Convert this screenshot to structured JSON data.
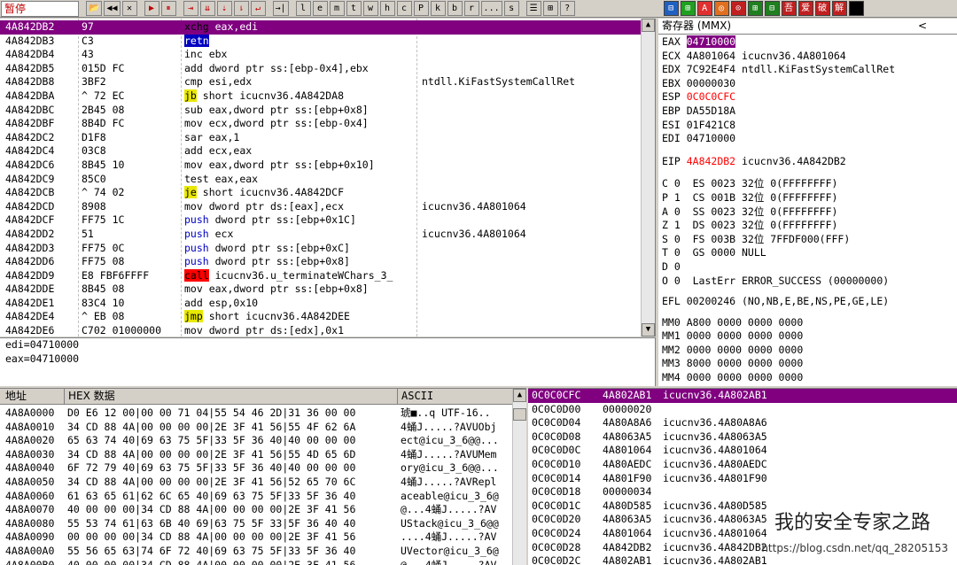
{
  "status": "暂停",
  "toolbar": {
    "buttons": [
      "📂",
      "◀◀",
      "✕",
      "▶",
      "⏸",
      "⇥",
      "⇊",
      "⇣",
      "⇂",
      "↵",
      "→|"
    ],
    "letters": [
      "l",
      "e",
      "m",
      "t",
      "w",
      "h",
      "c",
      "P",
      "k",
      "b",
      "r",
      "...",
      "s"
    ],
    "tools": [
      "☰",
      "⊞",
      "?"
    ],
    "plugins": [
      "⊟",
      "⊞",
      "A",
      "◎",
      "⊙",
      "⊞",
      "⊟",
      "吾",
      "爱",
      "破",
      "解",
      ""
    ]
  },
  "disasm": {
    "rows": [
      {
        "addr": "4A842DB2",
        "hex": "97",
        "mnem": "xchg",
        "ops": " eax,edi",
        "cmt": "",
        "kw": "xchg",
        "hl": true
      },
      {
        "addr": "4A842DB3",
        "hex": "C3",
        "mnem": "retn",
        "ops": "",
        "cmt": "",
        "kw": "retn",
        "hl": false
      },
      {
        "addr": "4A842DB4",
        "hex": "43",
        "mnem": "inc",
        "ops": " ebx",
        "cmt": "",
        "kw": "inc",
        "hl": false
      },
      {
        "addr": "4A842DB5",
        "hex": "015D FC",
        "mnem": "add",
        "ops": " dword ptr ss:[ebp-0x4],ebx",
        "cmt": "",
        "kw": "add",
        "hl": false
      },
      {
        "addr": "4A842DB8",
        "hex": "3BF2",
        "mnem": "cmp",
        "ops": " esi,edx",
        "cmt": "ntdll.KiFastSystemCallRet",
        "kw": "cmp",
        "hl": false
      },
      {
        "addr": "4A842DBA",
        "hex": "^ 72 EC",
        "mnem": "jb",
        "ops": " short icucnv36.4A842DA8",
        "cmt": "",
        "kw": "cjmp",
        "hl": false
      },
      {
        "addr": "4A842DBC",
        "hex": "2B45 08",
        "mnem": "sub",
        "ops": " eax,dword ptr ss:[ebp+0x8]",
        "cmt": "",
        "kw": "sub",
        "hl": false
      },
      {
        "addr": "4A842DBF",
        "hex": "8B4D FC",
        "mnem": "mov",
        "ops": " ecx,dword ptr ss:[ebp-0x4]",
        "cmt": "",
        "kw": "mov",
        "hl": false
      },
      {
        "addr": "4A842DC2",
        "hex": "D1F8",
        "mnem": "sar",
        "ops": " eax,1",
        "cmt": "",
        "kw": "sar",
        "hl": false
      },
      {
        "addr": "4A842DC4",
        "hex": "03C8",
        "mnem": "add",
        "ops": " ecx,eax",
        "cmt": "",
        "kw": "add",
        "hl": false
      },
      {
        "addr": "4A842DC6",
        "hex": "8B45 10",
        "mnem": "mov",
        "ops": " eax,dword ptr ss:[ebp+0x10]",
        "cmt": "",
        "kw": "mov",
        "hl": false
      },
      {
        "addr": "4A842DC9",
        "hex": "85C0",
        "mnem": "test",
        "ops": " eax,eax",
        "cmt": "",
        "kw": "test",
        "hl": false
      },
      {
        "addr": "4A842DCB",
        "hex": "^ 74 02",
        "mnem": "je",
        "ops": " short icucnv36.4A842DCF",
        "cmt": "",
        "kw": "cjmp",
        "hl": false
      },
      {
        "addr": "4A842DCD",
        "hex": "8908",
        "mnem": "mov",
        "ops": " dword ptr ds:[eax],ecx",
        "cmt": "icucnv36.4A801064",
        "kw": "mov",
        "hl": false
      },
      {
        "addr": "4A842DCF",
        "hex": "FF75 1C",
        "mnem": "push",
        "ops": " dword ptr ss:[ebp+0x1C]",
        "cmt": "",
        "kw": "push",
        "hl": false
      },
      {
        "addr": "4A842DD2",
        "hex": "51",
        "mnem": "push",
        "ops": " ecx",
        "cmt": "icucnv36.4A801064",
        "kw": "push",
        "hl": false
      },
      {
        "addr": "4A842DD3",
        "hex": "FF75 0C",
        "mnem": "push",
        "ops": " dword ptr ss:[ebp+0xC]",
        "cmt": "",
        "kw": "push",
        "hl": false
      },
      {
        "addr": "4A842DD6",
        "hex": "FF75 08",
        "mnem": "push",
        "ops": " dword ptr ss:[ebp+0x8]",
        "cmt": "",
        "kw": "push",
        "hl": false
      },
      {
        "addr": "4A842DD9",
        "hex": "E8 FBF6FFFF",
        "mnem": "call",
        "ops": " icucnv36.u_terminateWChars_3_",
        "cmt": "",
        "kw": "call",
        "hl": false
      },
      {
        "addr": "4A842DDE",
        "hex": "8B45 08",
        "mnem": "mov",
        "ops": " eax,dword ptr ss:[ebp+0x8]",
        "cmt": "",
        "kw": "mov",
        "hl": false
      },
      {
        "addr": "4A842DE1",
        "hex": "83C4 10",
        "mnem": "add",
        "ops": " esp,0x10",
        "cmt": "",
        "kw": "add",
        "hl": false
      },
      {
        "addr": "4A842DE4",
        "hex": "^ EB 08",
        "mnem": "jmp",
        "ops": " short icucnv36.4A842DEE",
        "cmt": "",
        "kw": "jmp",
        "hl": false
      },
      {
        "addr": "4A842DE6",
        "hex": "C702 01000000",
        "mnem": "mov",
        "ops": " dword ptr ds:[edx],0x1",
        "cmt": "",
        "kw": "mov",
        "hl": false
      }
    ]
  },
  "info": {
    "line1": "edi=04710000",
    "line2": "eax=04710000"
  },
  "registers": {
    "title": "寄存器 (MMX)",
    "nav": "<",
    "gp": [
      {
        "name": "EAX",
        "val": "04710000",
        "extra": "",
        "style": "box"
      },
      {
        "name": "ECX",
        "val": "4A801064",
        "extra": " icucnv36.4A801064",
        "style": ""
      },
      {
        "name": "EDX",
        "val": "7C92E4F4",
        "extra": " ntdll.KiFastSystemCallRet",
        "style": ""
      },
      {
        "name": "EBX",
        "val": "00000030",
        "extra": "",
        "style": ""
      },
      {
        "name": "ESP",
        "val": "0C0C0CFC",
        "extra": "",
        "style": "red"
      },
      {
        "name": "EBP",
        "val": "DA55D18A",
        "extra": "",
        "style": ""
      },
      {
        "name": "ESI",
        "val": "01F421C8",
        "extra": "",
        "style": ""
      },
      {
        "name": "EDI",
        "val": "04710000",
        "extra": "",
        "style": ""
      }
    ],
    "eip": {
      "name": "EIP",
      "val": "4A842DB2",
      "extra": " icucnv36.4A842DB2"
    },
    "flags": [
      "C 0  ES 0023 32位 0(FFFFFFFF)",
      "P 1  CS 001B 32位 0(FFFFFFFF)",
      "A 0  SS 0023 32位 0(FFFFFFFF)",
      "Z 1  DS 0023 32位 0(FFFFFFFF)",
      "S 0  FS 003B 32位 7FFDF000(FFF)",
      "T 0  GS 0000 NULL",
      "D 0",
      "O 0  LastErr ERROR_SUCCESS (00000000)"
    ],
    "efl": "EFL 00200246 (NO,NB,E,BE,NS,PE,GE,LE)",
    "mm": [
      "MM0 A800 0000 0000 0000",
      "MM1 0000 0000 0000 0000",
      "MM2 0000 0000 0000 0000",
      "MM3 8000 0000 0000 0000",
      "MM4 0000 0000 0000 0000"
    ]
  },
  "dump": {
    "header": {
      "addr": "地址",
      "hex": "HEX 数据",
      "ascii": "ASCII"
    },
    "rows": [
      {
        "addr": "4A8A0000",
        "hex": "D0 E6 12 00|00 00 71 04|55 54 46 2D|31 36 00 00",
        "ascii": "琥■..q UTF-16.."
      },
      {
        "addr": "4A8A0010",
        "hex": "34 CD 88 4A|00 00 00 00|2E 3F 41 56|55 4F 62 6A",
        "ascii": "4蛹J.....?AVUObj"
      },
      {
        "addr": "4A8A0020",
        "hex": "65 63 74 40|69 63 75 5F|33 5F 36 40|40 00 00 00",
        "ascii": "ect@icu_3_6@@..."
      },
      {
        "addr": "4A8A0030",
        "hex": "34 CD 88 4A|00 00 00 00|2E 3F 41 56|55 4D 65 6D",
        "ascii": "4蛹J.....?AVUMem"
      },
      {
        "addr": "4A8A0040",
        "hex": "6F 72 79 40|69 63 75 5F|33 5F 36 40|40 00 00 00",
        "ascii": "ory@icu_3_6@@..."
      },
      {
        "addr": "4A8A0050",
        "hex": "34 CD 88 4A|00 00 00 00|2E 3F 41 56|52 65 70 6C",
        "ascii": "4蛹J.....?AVRepl"
      },
      {
        "addr": "4A8A0060",
        "hex": "61 63 65 61|62 6C 65 40|69 63 75 5F|33 5F 36 40",
        "ascii": "aceable@icu_3_6@"
      },
      {
        "addr": "4A8A0070",
        "hex": "40 00 00 00|34 CD 88 4A|00 00 00 00|2E 3F 41 56",
        "ascii": "@...4蛹J.....?AV"
      },
      {
        "addr": "4A8A0080",
        "hex": "55 53 74 61|63 6B 40 69|63 75 5F 33|5F 36 40 40",
        "ascii": "UStack@icu_3_6@@"
      },
      {
        "addr": "4A8A0090",
        "hex": "00 00 00 00|34 CD 88 4A|00 00 00 00|2E 3F 41 56",
        "ascii": "....4蛹J.....?AV"
      },
      {
        "addr": "4A8A00A0",
        "hex": "55 56 65 63|74 6F 72 40|69 63 75 5F|33 5F 36 40",
        "ascii": "UVector@icu_3_6@"
      },
      {
        "addr": "4A8A00B0",
        "hex": "40 00 00 00|34 CD 88 4A|00 00 00 00|2E 3F 41 56",
        "ascii": "@...4蛹J.....?AV"
      }
    ]
  },
  "stack": {
    "rows": [
      {
        "addr": "0C0C0CFC",
        "val": "4A802AB1",
        "cmt": "icucnv36.4A802AB1",
        "hl": true
      },
      {
        "addr": "0C0C0D00",
        "val": "00000020",
        "cmt": "",
        "hl": false
      },
      {
        "addr": "0C0C0D04",
        "val": "4A80A8A6",
        "cmt": "icucnv36.4A80A8A6",
        "hl": false
      },
      {
        "addr": "0C0C0D08",
        "val": "4A8063A5",
        "cmt": "icucnv36.4A8063A5",
        "hl": false
      },
      {
        "addr": "0C0C0D0C",
        "val": "4A801064",
        "cmt": "icucnv36.4A801064",
        "hl": false
      },
      {
        "addr": "0C0C0D10",
        "val": "4A80AEDC",
        "cmt": "icucnv36.4A80AEDC",
        "hl": false
      },
      {
        "addr": "0C0C0D14",
        "val": "4A801F90",
        "cmt": "icucnv36.4A801F90",
        "hl": false
      },
      {
        "addr": "0C0C0D18",
        "val": "00000034",
        "cmt": "",
        "hl": false
      },
      {
        "addr": "0C0C0D1C",
        "val": "4A80D585",
        "cmt": "icucnv36.4A80D585",
        "hl": false
      },
      {
        "addr": "0C0C0D20",
        "val": "4A8063A5",
        "cmt": "icucnv36.4A8063A5",
        "hl": false
      },
      {
        "addr": "0C0C0D24",
        "val": "4A801064",
        "cmt": "icucnv36.4A801064",
        "hl": false
      },
      {
        "addr": "0C0C0D28",
        "val": "4A842DB2",
        "cmt": "icucnv36.4A842DB2",
        "hl": false
      },
      {
        "addr": "0C0C0D2C",
        "val": "4A802AB1",
        "cmt": "icucnv36.4A802AB1",
        "hl": false
      }
    ]
  },
  "watermark": "我的安全专家之路",
  "url": "https://blog.csdn.net/qq_28205153",
  "colors": {
    "highlight": "#800080",
    "jump": "#e8e800",
    "call": "#ff0000",
    "push": "#0000c0",
    "changed": "#ff0000"
  }
}
